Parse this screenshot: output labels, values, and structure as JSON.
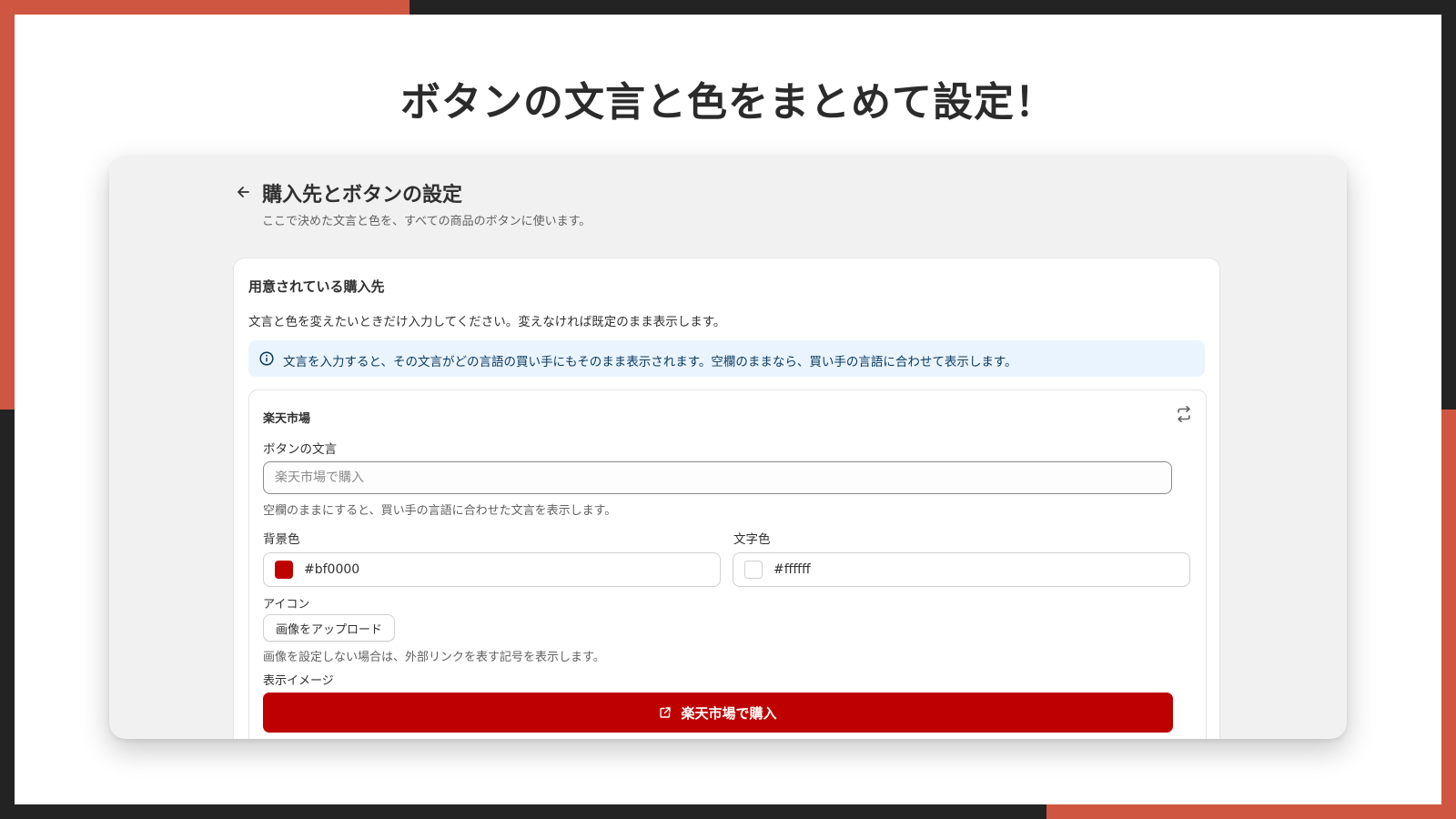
{
  "slide": {
    "title": "ボタンの文言と色をまとめて設定！"
  },
  "page": {
    "title": "購入先とボタンの設定",
    "subtitle": "ここで決めた文言と色を、すべての商品のボタンに使います。"
  },
  "section": {
    "title": "用意されている購入先",
    "description": "文言と色を変えたいときだけ入力してください。変えなければ既定のまま表示します。",
    "banner_text": "文言を入力すると、その文言がどの言語の買い手にもそのまま表示されます。空欄のままなら、買い手の言語に合わせて表示します。"
  },
  "store": {
    "name": "楽天市場",
    "button_text_label": "ボタンの文言",
    "button_text_value": "",
    "button_text_placeholder": "楽天市場で購入",
    "button_text_help": "空欄のままにすると、買い手の言語に合わせた文言を表示します。",
    "bg_color_label": "背景色",
    "bg_color_value": "#bf0000",
    "text_color_label": "文字色",
    "text_color_value": "#ffffff",
    "icon_label": "アイコン",
    "upload_button": "画像をアップロード",
    "icon_help": "画像を設定しない場合は、外部リンクを表す記号を表示します。",
    "preview_label": "表示イメージ",
    "preview_button_text": "楽天市場で購入"
  },
  "colors": {
    "accent": "#cf5640",
    "dark": "#232323",
    "banner_bg": "#eaf4ff"
  },
  "icons": [
    "back-arrow-icon",
    "info-icon",
    "reset-icon",
    "external-link-icon"
  ]
}
